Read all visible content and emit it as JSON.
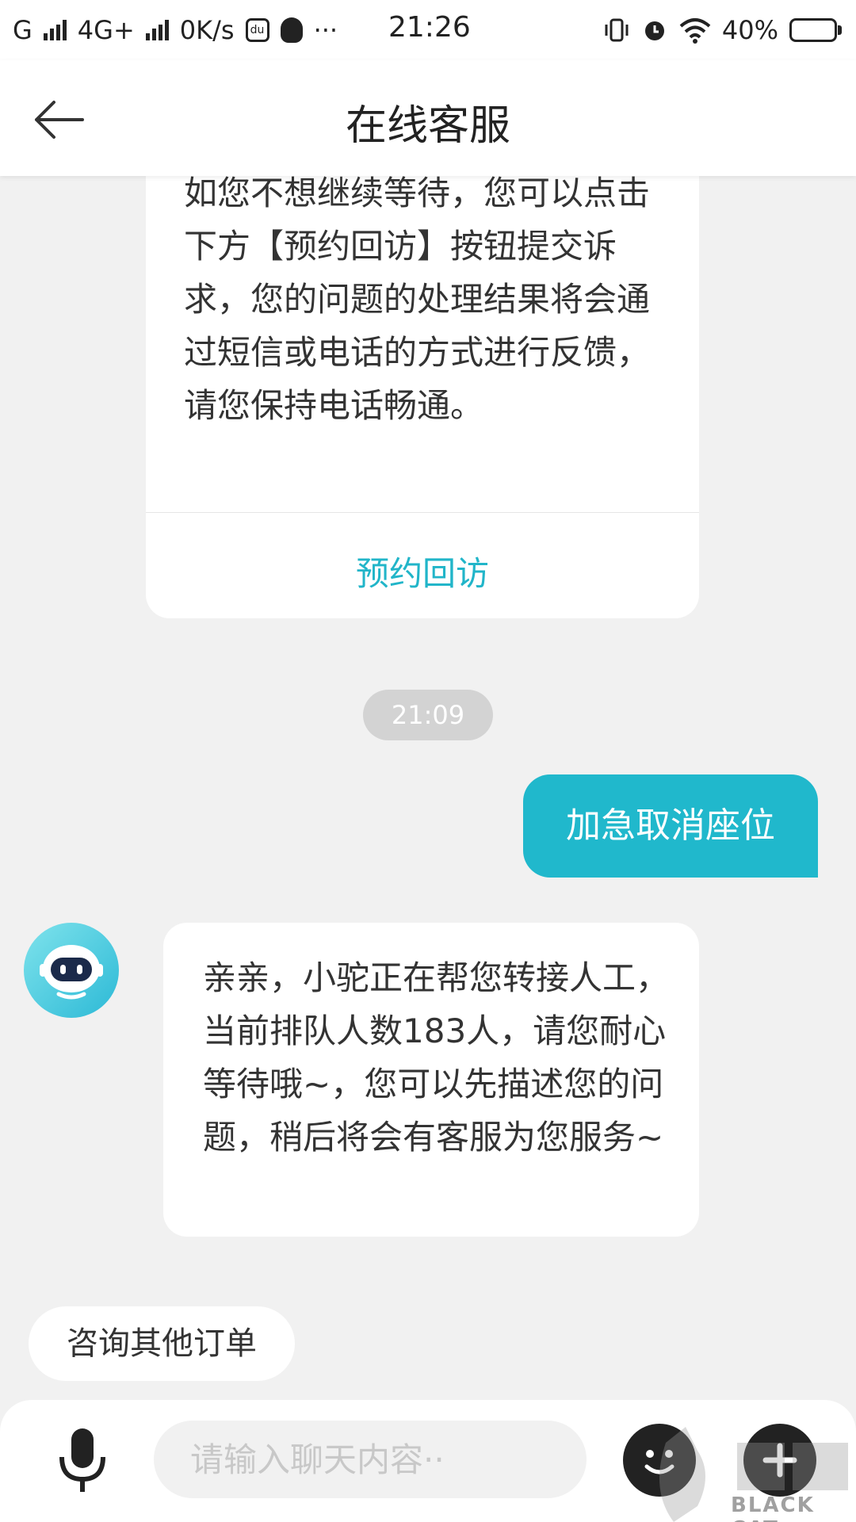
{
  "status_bar": {
    "carrier1": "G",
    "carrier2": "4G+",
    "speed": "0K/s",
    "time": "21:26",
    "battery": "40%",
    "battery_level": 0.4,
    "battery_color": "#f06a5b"
  },
  "header": {
    "title": "在线客服",
    "back_icon": "arrow-left-icon"
  },
  "messages": {
    "agent_card": {
      "text": "如您不想继续等待，您可以点击下方【预约回访】按钮提交诉求，您的问题的处理结果将会通过短信或电话的方式进行反馈，请您保持电话畅通。",
      "action_label": "预约回访"
    },
    "timestamp": "21:09",
    "user_message": "加急取消座位",
    "bot_message": "亲亲，小驼正在帮您转接人工，当前排队人数183人，请您耐心等待哦~，您可以先描述您的问题，稍后将会有客服为您服务~"
  },
  "quick_reply": {
    "label": "咨询其他订单"
  },
  "input_bar": {
    "placeholder": "请输入聊天内容··",
    "mic_icon": "microphone-icon",
    "emoji_icon": "emoji-icon",
    "plus_icon": "plus-icon"
  },
  "watermark": {
    "text": "BLACK CAT"
  },
  "colors": {
    "accent": "#21b5c9",
    "user_bubble": "#20b8cc",
    "background": "#f1f1f1"
  }
}
